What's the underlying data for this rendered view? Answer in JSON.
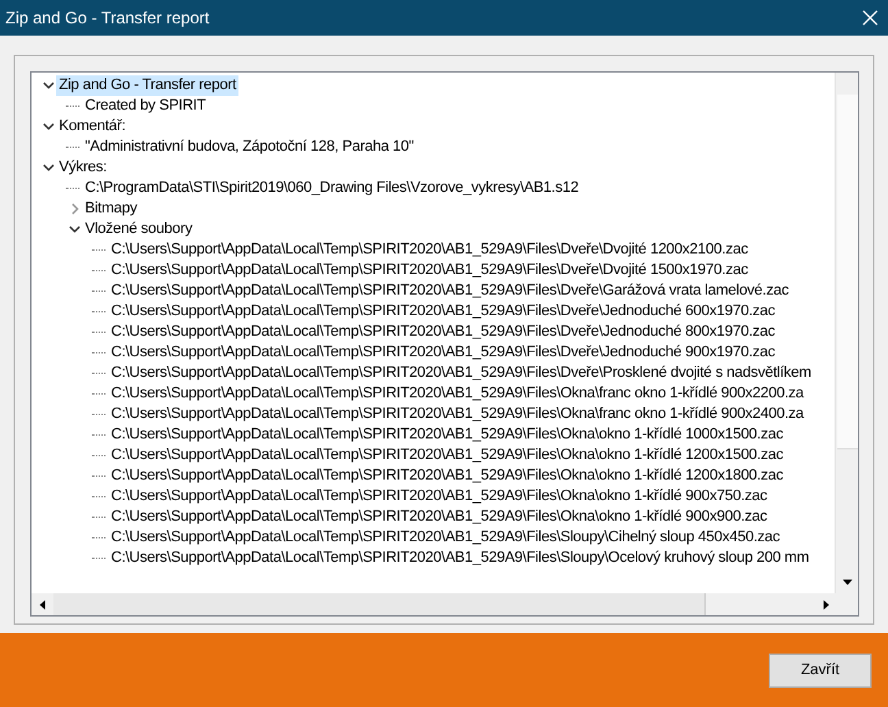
{
  "window": {
    "title": "Zip and Go - Transfer report"
  },
  "tree": {
    "items": [
      {
        "label": "Zip and Go - Transfer report",
        "expanded": true,
        "selected": true,
        "children": [
          {
            "label": "Created by SPIRIT",
            "selected": false
          }
        ]
      },
      {
        "label": "Komentář:",
        "expanded": true,
        "selected": false,
        "children": [
          {
            "label": "\"Administrativní budova, Zápotoční 128, Paraha 10\"",
            "selected": false
          }
        ]
      },
      {
        "label": "Výkres:",
        "expanded": true,
        "selected": false,
        "children": [
          {
            "label": "C:\\ProgramData\\STI\\Spirit2019\\060_Drawing Files\\Vzorove_vykresy\\AB1.s12",
            "selected": false
          },
          {
            "label": "Bitmapy",
            "expanded": false,
            "selected": false
          },
          {
            "label": "Vložené soubory",
            "expanded": true,
            "selected": false,
            "children": [
              {
                "label": "C:\\Users\\Support\\AppData\\Local\\Temp\\SPIRIT2020\\AB1_529A9\\Files\\Dveře\\Dvojité 1200x2100.zac",
                "selected": false
              },
              {
                "label": "C:\\Users\\Support\\AppData\\Local\\Temp\\SPIRIT2020\\AB1_529A9\\Files\\Dveře\\Dvojité 1500x1970.zac",
                "selected": false
              },
              {
                "label": "C:\\Users\\Support\\AppData\\Local\\Temp\\SPIRIT2020\\AB1_529A9\\Files\\Dveře\\Garážová vrata lamelové.zac",
                "selected": false
              },
              {
                "label": "C:\\Users\\Support\\AppData\\Local\\Temp\\SPIRIT2020\\AB1_529A9\\Files\\Dveře\\Jednoduché 600x1970.zac",
                "selected": false
              },
              {
                "label": "C:\\Users\\Support\\AppData\\Local\\Temp\\SPIRIT2020\\AB1_529A9\\Files\\Dveře\\Jednoduché 800x1970.zac",
                "selected": false
              },
              {
                "label": "C:\\Users\\Support\\AppData\\Local\\Temp\\SPIRIT2020\\AB1_529A9\\Files\\Dveře\\Jednoduché 900x1970.zac",
                "selected": false
              },
              {
                "label": "C:\\Users\\Support\\AppData\\Local\\Temp\\SPIRIT2020\\AB1_529A9\\Files\\Dveře\\Prosklené dvojité s nadsvětlíkem",
                "selected": false
              },
              {
                "label": "C:\\Users\\Support\\AppData\\Local\\Temp\\SPIRIT2020\\AB1_529A9\\Files\\Okna\\franc okno 1-křídlé 900x2200.za",
                "selected": false
              },
              {
                "label": "C:\\Users\\Support\\AppData\\Local\\Temp\\SPIRIT2020\\AB1_529A9\\Files\\Okna\\franc okno 1-křídlé 900x2400.za",
                "selected": false
              },
              {
                "label": "C:\\Users\\Support\\AppData\\Local\\Temp\\SPIRIT2020\\AB1_529A9\\Files\\Okna\\okno 1-křídlé 1000x1500.zac",
                "selected": false
              },
              {
                "label": "C:\\Users\\Support\\AppData\\Local\\Temp\\SPIRIT2020\\AB1_529A9\\Files\\Okna\\okno 1-křídlé 1200x1500.zac",
                "selected": false
              },
              {
                "label": "C:\\Users\\Support\\AppData\\Local\\Temp\\SPIRIT2020\\AB1_529A9\\Files\\Okna\\okno 1-křídlé 1200x1800.zac",
                "selected": false
              },
              {
                "label": "C:\\Users\\Support\\AppData\\Local\\Temp\\SPIRIT2020\\AB1_529A9\\Files\\Okna\\okno 1-křídlé 900x750.zac",
                "selected": false
              },
              {
                "label": "C:\\Users\\Support\\AppData\\Local\\Temp\\SPIRIT2020\\AB1_529A9\\Files\\Okna\\okno 1-křídlé 900x900.zac",
                "selected": false
              },
              {
                "label": "C:\\Users\\Support\\AppData\\Local\\Temp\\SPIRIT2020\\AB1_529A9\\Files\\Sloupy\\Cihelný sloup 450x450.zac",
                "selected": false
              },
              {
                "label": "C:\\Users\\Support\\AppData\\Local\\Temp\\SPIRIT2020\\AB1_529A9\\Files\\Sloupy\\Ocelový kruhový sloup 200 mm",
                "selected": false
              }
            ]
          }
        ]
      }
    ]
  },
  "buttons": [
    {
      "label": "Zavřít"
    }
  ]
}
